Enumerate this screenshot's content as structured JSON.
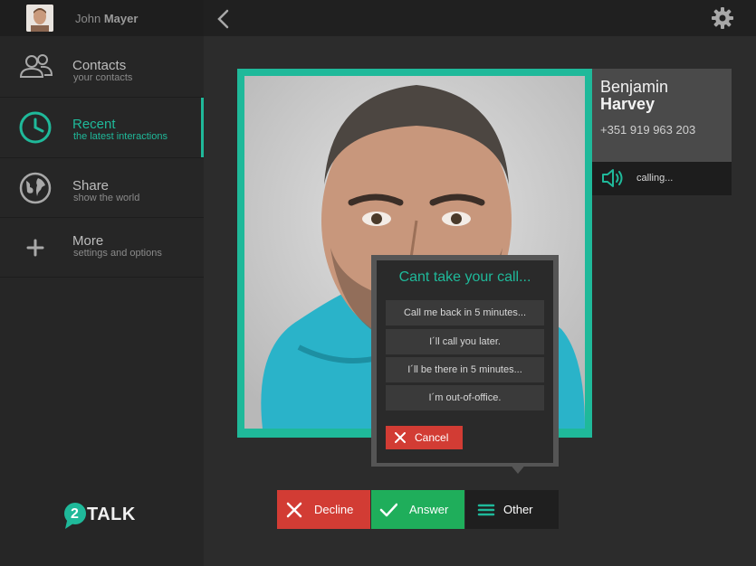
{
  "user": {
    "first_name": "John",
    "last_name": "Mayer"
  },
  "sidebar": {
    "items": [
      {
        "title": "Contacts",
        "subtitle": "your contacts",
        "icon": "contacts-icon"
      },
      {
        "title": "Recent",
        "subtitle": "the latest interactions",
        "icon": "clock-icon",
        "active": true
      },
      {
        "title": "Share",
        "subtitle": "show the world",
        "icon": "globe-icon"
      },
      {
        "title": "More",
        "subtitle": "settings and options",
        "icon": "plus-icon"
      }
    ]
  },
  "brand": {
    "logo_digit": "2",
    "logo_text": "TALK"
  },
  "caller": {
    "first_name": "Benjamin",
    "last_name": "Harvey",
    "phone": "+351 919 963 203",
    "status": "calling..."
  },
  "popup": {
    "title": "Cant take your call...",
    "replies": [
      "Call me back in 5 minutes...",
      "I´ll call you later.",
      "I´ll be there in 5 minutes...",
      "I´m out-of-office."
    ],
    "cancel_label": "Cancel"
  },
  "actions": {
    "decline_label": "Decline",
    "answer_label": "Answer",
    "other_label": "Other"
  },
  "colors": {
    "accent": "#1fb99a",
    "decline": "#d23c34",
    "answer": "#1fae5b",
    "background": "#2c2c2c"
  }
}
